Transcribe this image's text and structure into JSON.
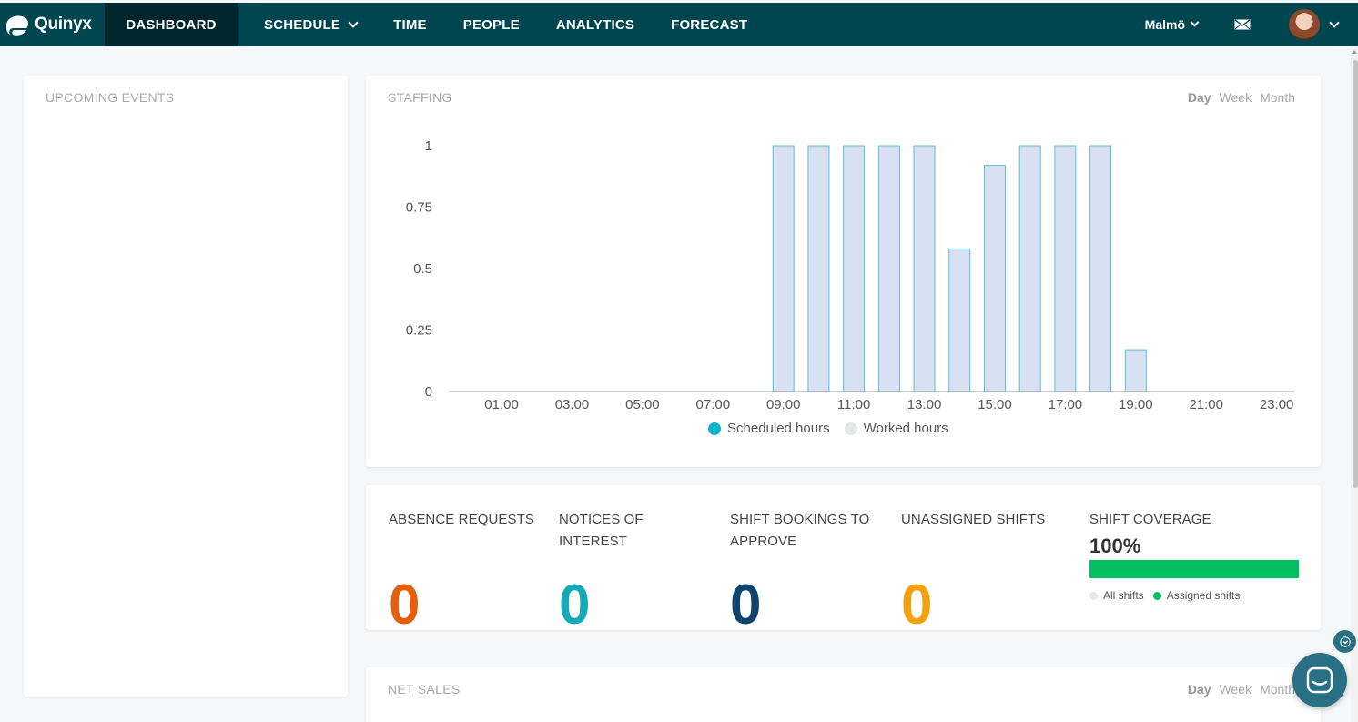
{
  "app": {
    "name": "Quinyx"
  },
  "nav": {
    "items": [
      {
        "label": "DASHBOARD",
        "active": true
      },
      {
        "label": "SCHEDULE",
        "dropdown": true
      },
      {
        "label": "TIME"
      },
      {
        "label": "PEOPLE"
      },
      {
        "label": "ANALYTICS"
      },
      {
        "label": "FORECAST"
      }
    ],
    "location": "Malmö"
  },
  "upcoming_events": {
    "title": "UPCOMING EVENTS"
  },
  "staffing": {
    "title": "STAFFING",
    "periods": [
      "Day",
      "Week",
      "Month"
    ],
    "selected_period": "Day",
    "legend": [
      {
        "label": "Scheduled hours",
        "color": "#13b3c9"
      },
      {
        "label": "Worked hours",
        "color": "#e6e7e9"
      }
    ],
    "chart_data": {
      "type": "bar",
      "categories": [
        "00:00",
        "01:00",
        "02:00",
        "03:00",
        "04:00",
        "05:00",
        "06:00",
        "07:00",
        "08:00",
        "09:00",
        "10:00",
        "11:00",
        "12:00",
        "13:00",
        "14:00",
        "15:00",
        "16:00",
        "17:00",
        "18:00",
        "19:00",
        "20:00",
        "21:00",
        "22:00",
        "23:00"
      ],
      "x_tick_labels": [
        "01:00",
        "03:00",
        "05:00",
        "07:00",
        "09:00",
        "11:00",
        "13:00",
        "15:00",
        "17:00",
        "19:00",
        "21:00",
        "23:00"
      ],
      "y_ticks": [
        "0",
        "0.25",
        "0.5",
        "0.75",
        "1"
      ],
      "series": [
        {
          "name": "Scheduled hours",
          "values": [
            0,
            0,
            0,
            0,
            0,
            0,
            0,
            0,
            0,
            1,
            1,
            1,
            1,
            1,
            0.58,
            0.92,
            1,
            1,
            1,
            0.17,
            0,
            0,
            0,
            0
          ]
        }
      ],
      "ylim": [
        0,
        1
      ],
      "grid": false,
      "legend_position": "bottom"
    }
  },
  "stats": {
    "absence_requests": {
      "label": "ABSENCE REQUESTS",
      "value": "0",
      "color": "#e2600e"
    },
    "notices_of_interest": {
      "label": "NOTICES OF INTEREST",
      "value": "0",
      "color": "#16aab8"
    },
    "shift_bookings": {
      "label": "SHIFT BOOKINGS TO APPROVE",
      "value": "0",
      "color": "#0f4470"
    },
    "unassigned_shifts": {
      "label": "UNASSIGNED SHIFTS",
      "value": "0",
      "color": "#f5a00f"
    },
    "shift_coverage": {
      "label": "SHIFT COVERAGE",
      "value": "100%",
      "fraction": 1.0,
      "legend": [
        {
          "label": "All shifts",
          "color": "#e6e7e9"
        },
        {
          "label": "Assigned shifts",
          "color": "#00c060"
        }
      ]
    }
  },
  "net_sales": {
    "title": "NET SALES",
    "periods": [
      "Day",
      "Week",
      "Month"
    ],
    "selected_period": "Day"
  },
  "colors": {
    "nav_bg": "#004651",
    "nav_active": "#00262d",
    "bar_fill": "#d8e1f1",
    "bar_stroke": "#5bc0d6"
  }
}
